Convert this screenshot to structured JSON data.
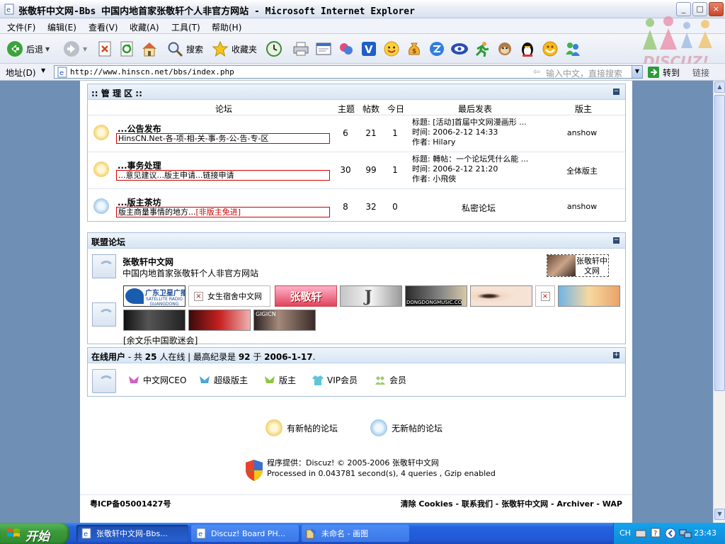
{
  "window": {
    "title": "张敬轩中文网-Bbs 中国内地首家张敬轩个人非官方网站 - Microsoft Internet Explorer",
    "min_label": "_",
    "max_label": "□",
    "close_label": "×"
  },
  "menu": [
    "文件(F)",
    "编辑(E)",
    "查看(V)",
    "收藏(A)",
    "工具(T)",
    "帮助(H)"
  ],
  "toolbar": {
    "back_label": "后退",
    "search_label": "搜索",
    "favorites_label": "收藏夹"
  },
  "address": {
    "label": "地址(D)",
    "url": "http://www.hinscn.net/bbs/index.php",
    "hint": "输入中文，直接搜索",
    "go_label": "转到",
    "links_label": "链接"
  },
  "watermark": "DISCUZ!",
  "admin_section": {
    "title": ":: 管 理 区 ::",
    "columns": {
      "forum": "论坛",
      "topics": "主题",
      "posts": "帖数",
      "today": "今日",
      "last_post": "最后发表",
      "moderator": "版主"
    },
    "forums": [
      {
        "name": "...公告发布",
        "desc": "HinsCN.Net-各-项-相-关-事-务-公-告-专-区",
        "desc_extra": "",
        "topics": "6",
        "posts": "21",
        "today": "1",
        "last_title": "标题: [活动]首届中文网漫画形 ...",
        "last_time": "时间: 2006-2-12 14:33",
        "last_author": "作者: Hilary",
        "moderator": "anshow",
        "status": "new"
      },
      {
        "name": "...事务处理",
        "desc": "...意见建议...版主申请...链接申请",
        "desc_extra": "",
        "topics": "30",
        "posts": "99",
        "today": "1",
        "last_title": "标题: 轉帖：一个论坛凭什么能 ...",
        "last_time": "时间: 2006-2-12 21:20",
        "last_author": "作者: 小飛俠",
        "moderator": "全体版主",
        "status": "new"
      },
      {
        "name": "...版主茶坊",
        "desc": "版主商量事情的地方...",
        "desc_extra": "[非版主免进]",
        "topics": "8",
        "posts": "32",
        "today": "0",
        "last_private": "私密论坛",
        "moderator": "anshow",
        "status": "old"
      }
    ]
  },
  "alliance": {
    "title": "联盟论坛",
    "site_name": "张敬轩中文网",
    "site_desc": "中国内地首家张敬轩个人非官方网站",
    "logo_text": "张敬轩中文网",
    "links": {
      "gd_radio": "广东卫星广播",
      "gd_radio_en": "SATELLITE RADIO GUANGDONG",
      "dorm": "女生宿舍中文网",
      "hins_logo": "张敬轩",
      "dongdong": "DONGDONGMUSIC.CO",
      "gigicn": "GIGICN",
      "yu_text": "[余文乐中国歌迷会]"
    }
  },
  "online": {
    "label": "在线用户",
    "stats_prefix": " - 共 ",
    "count": "25",
    "stats_mid": " 人在线 | 最高纪录是 ",
    "record": "92",
    "stats_mid2": " 于 ",
    "record_date": "2006-1-17",
    "stats_end": ".",
    "groups": [
      "中文网CEO",
      "超级版主",
      "版主",
      "VIP会员",
      "会员"
    ]
  },
  "legend": {
    "new": "有新帖的论坛",
    "old": "无新帖的论坛"
  },
  "powered": {
    "line1": "程序提供：Discuz!  © 2005-2006 张敬轩中文网",
    "line2": "Processed in 0.043781 second(s), 4 queries , Gzip enabled"
  },
  "footer": {
    "icp": "粤ICP备05001427号",
    "links": [
      "清除 Cookies",
      "联系我们",
      "张敬轩中文网",
      "Archiver",
      "WAP"
    ],
    "sep": " - "
  },
  "taskbar": {
    "start": "开始",
    "tasks": [
      "张敬轩中文网-Bbs...",
      "Discuz! Board PH...",
      "未命名 - 画图"
    ],
    "lang": "CH",
    "clock": "23:43"
  },
  "colors": {
    "accent": "#2d4a73",
    "border_red": "#cc0000",
    "page_bg": "#6f8fb4"
  }
}
